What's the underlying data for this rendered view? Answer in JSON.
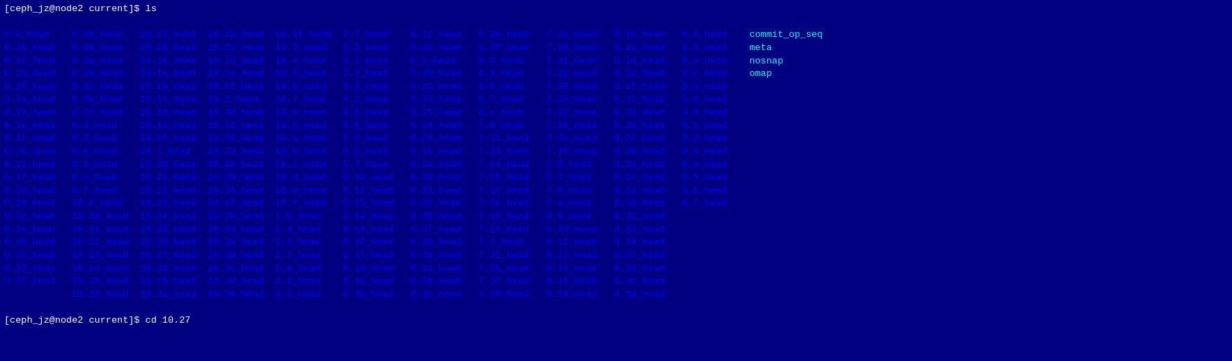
{
  "terminal": {
    "prompt1": "[ceph_jz@node2 current]$ ls",
    "prompt2": "[ceph_jz@node2 current]$ cd 10.27",
    "columns": [
      [
        "0.0_head",
        "0.16_head",
        "0.17_head",
        "0.18_head",
        "0.19_head",
        "0.1a_head",
        "0.1d_head",
        "0.1e_head",
        "0.1f_head",
        "0.20_head",
        "0.21_head",
        "0.27_head",
        "0.28_head",
        "0.29_head",
        "0.2c_head",
        "0.2e_head",
        "0.30_head",
        "0.31_head",
        "0.32_head",
        "0.37_head"
      ],
      [
        "0.38_head",
        "0.39_head",
        "0.3a_head",
        "0.3b_head",
        "0.3c_head",
        "0.3e_head",
        "0.3f_head",
        "0.3_head",
        "0.5_head",
        "0.6_head",
        "0.9_head",
        "0.e_head",
        "0.f_head",
        "10.0_head",
        "10.10_head",
        "10.11_head",
        "10.12_head",
        "10.13_head",
        "10.14_head",
        "10.15_head",
        "10.16_head"
      ],
      [
        "10.17_head",
        "10.18_head",
        "10.19_head",
        "10.1a_head",
        "10.1b_head",
        "10.1c_head",
        "10.1d_head",
        "10.1e_head",
        "10.1f_head",
        "10.1_head",
        "10.20_head",
        "10.21_head",
        "10.22_head",
        "10.23_head",
        "10.24_head",
        "10.25_head",
        "10.26_head",
        "10.27_head",
        "10.28_head",
        "10.29_head",
        "10.2a_head"
      ],
      [
        "10.2b_head",
        "10.2c_head",
        "10.2d_head",
        "10.2e_head",
        "10.2f_head",
        "10.2_head",
        "10.30_head",
        "10.31_head",
        "10.32_head",
        "10.33_head",
        "10.34_head",
        "10.35_head",
        "10.36_head",
        "10.37_head",
        "10.38_head",
        "10.39_head",
        "10.3a_head",
        "10.3b_head",
        "10.3c_head",
        "10.3d_head",
        "10.3e_head"
      ],
      [
        "10.3f_head",
        "10.3_head",
        "10.4_head",
        "10.5_head",
        "10.6_head",
        "10.7_head",
        "10.8_head",
        "10.9_head",
        "10.a_head",
        "10.b_head",
        "10.c_head",
        "10.d_head",
        "10.e_head",
        "10.f_head",
        "1.0_head",
        "1.4_head",
        "1.5_head",
        "1.7_head",
        "2.0_head",
        "2.2_head",
        "2.5_head"
      ],
      [
        "2.7_head",
        "3.2_head",
        "3.3_head",
        "3.7_head",
        "4.2_head",
        "4.3_head",
        "4.5_head",
        "4.6_head",
        "5.0_head",
        "5.2_head",
        "5.7_head",
        "6.10_head",
        "6.12_head",
        "6.13_head",
        "6.14_head",
        "6.15_head",
        "6.16_head",
        "6.17_head",
        "6.18_head",
        "6.1a_head",
        "6.1b_head"
      ],
      [
        "6.1c_head",
        "6.1e_head",
        "6.1_head",
        "6.20_head",
        "6.22_head",
        "6.23_head",
        "6.25_head",
        "6.28_head",
        "6.29_head",
        "6.2b_head",
        "6.2e_head",
        "6.30_head",
        "6.31_head",
        "6.32_head",
        "6.36_head",
        "6.37_head",
        "6.38_head",
        "6.39_head",
        "6.3a_head",
        "6.3b_head",
        "6.3c_head"
      ],
      [
        "6.3e_head",
        "6.3f_head",
        "6.3_head",
        "6.4_head",
        "6.6_head",
        "6.7_head",
        "6.c_head",
        "7.0_head",
        "7.11_head",
        "7.13_head",
        "7.14_head",
        "7.15_head",
        "7.17_head",
        "7.1c_head",
        "7.1e_head",
        "7.1f_head",
        "7.1_head",
        "7.21_head",
        "7.25_head",
        "7.27_head",
        "7.29_head"
      ],
      [
        "7.2a_head",
        "7.30_head",
        "7.31_head",
        "7.32_head",
        "7.35_head",
        "7.36_head",
        "7.37_head",
        "7.38_head",
        "7.3e_head",
        "7.3f_head",
        "7.5_head",
        "7.7_head",
        "7.8_head",
        "7.a_head",
        "8.0_head",
        "8.10_head",
        "8.11_head",
        "8.13_head",
        "8.14_head",
        "8.15_head",
        "8.16_head"
      ],
      [
        "8.1b_head",
        "8.1c_head",
        "8.1d_head",
        "8.1e_head",
        "8.1f_head",
        "8.22_head",
        "8.23_head",
        "8.26_head",
        "8.27_head",
        "8.28_head",
        "8.2b_head",
        "8.2c_head",
        "8.2d_head",
        "8.30_head",
        "8.31_head",
        "8.33_head",
        "8.34_head",
        "8.37_head",
        "8.39_head",
        "8.3c_head",
        "8.3d_head"
      ],
      [
        "8.6_head",
        "8.9_head",
        "8.b_head",
        "8.c_head",
        "8.d_head",
        "8.e_head",
        "9.0_head",
        "9.1_head",
        "9.2_head",
        "9.3_head",
        "9.4_head",
        "9.5_head",
        "9.6_head",
        "9.7_head"
      ],
      [
        "commit_op_seq",
        "meta",
        "nosnap",
        "omap"
      ]
    ]
  }
}
